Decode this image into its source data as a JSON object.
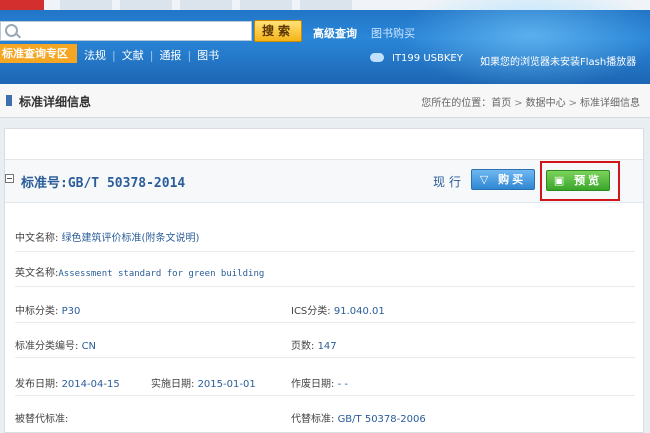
{
  "search": {
    "button": "搜索",
    "advanced": "高级查询",
    "book_buy": "图书购买"
  },
  "nav": {
    "zone": "标准查询专区",
    "links": [
      "法规",
      "文献",
      "通报",
      "图书"
    ]
  },
  "infobar": {
    "phone": "IT199 USBKEY",
    "notice": "如果您的浏览器未安装Flash播放器"
  },
  "page": {
    "title": "标准详细信息",
    "breadcrumb": {
      "prefix": "您所在的位置：",
      "items": [
        "首页",
        "数据中心",
        "标准详细信息"
      ]
    }
  },
  "standard": {
    "number": "标准号:GB/T 50378-2014",
    "status": "现行",
    "buy_label": "购买",
    "preview_label": "预览",
    "fields": {
      "cn_name_label": "中文名称:",
      "cn_name": "绿色建筑评价标准(附条文说明)",
      "en_name_label": "英文名称:",
      "en_name": "Assessment standard for green building",
      "ccs_label": "中标分类:",
      "ccs": "P30",
      "ics_label": "ICS分类:",
      "ics": "91.040.01",
      "cat_code_label": "标准分类编号:",
      "cat_code": "CN",
      "pages_label": "页数:",
      "pages": "147",
      "issue_label": "发布日期:",
      "issue": "2014-04-15",
      "impl_label": "实施日期:",
      "impl": "2015-01-01",
      "void_label": "作废日期:",
      "void": "- -",
      "replaced_by_label": "被替代标准:",
      "replaces_label": "代替标准:",
      "replaces": "GB/T 50378-2006"
    }
  },
  "colors": {
    "header": "#2a86d8",
    "zone": "#f5a623",
    "link": "#2a5d99",
    "highlight": "#d0141a",
    "preview": "#3aa52a"
  }
}
